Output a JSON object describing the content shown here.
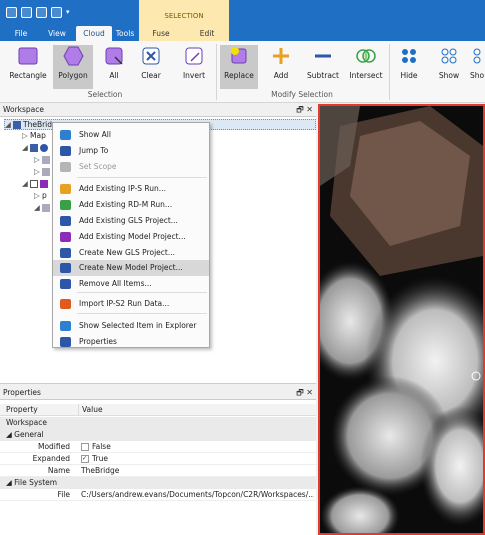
{
  "ribbon_tabs": {
    "file": "File",
    "view": "View",
    "cloud": "Cloud",
    "tools": "Tools",
    "fuse": "Fuse",
    "edit": "Edit",
    "context_group": "SELECTION"
  },
  "ribbon_buttons": {
    "rectangle": "Rectangle",
    "polygon": "Polygon",
    "all": "All",
    "clear": "Clear",
    "invert": "Invert",
    "replace": "Replace",
    "add": "Add",
    "subtract": "Subtract",
    "intersect": "Intersect",
    "hide": "Hide",
    "show": "Show",
    "show_all_partial": "Sho"
  },
  "ribbon_groups": {
    "selection": "Selection",
    "modify_selection": "Modify Selection"
  },
  "workspace": {
    "title": "Workspace",
    "root": "TheBridge",
    "map_item": "Map"
  },
  "context_menu": [
    {
      "label": "Show All",
      "icon": "show-all-icon",
      "enabled": true
    },
    {
      "label": "Jump To",
      "icon": "jump-to-icon",
      "enabled": true
    },
    {
      "label": "Set Scope",
      "icon": "set-scope-icon",
      "enabled": false
    },
    {
      "label": "Add Existing IP-S Run...",
      "icon": "ips-run-icon",
      "enabled": true
    },
    {
      "label": "Add Existing RD-M Run...",
      "icon": "rdm-run-icon",
      "enabled": true
    },
    {
      "label": "Add Existing GLS Project...",
      "icon": "gls-project-icon",
      "enabled": true
    },
    {
      "label": "Add Existing Model Project...",
      "icon": "model-project-icon",
      "enabled": true
    },
    {
      "label": "Create New GLS Project...",
      "icon": "new-gls-icon",
      "enabled": true
    },
    {
      "label": "Create New Model Project...",
      "icon": "new-model-icon",
      "enabled": true,
      "highlighted": true
    },
    {
      "label": "Remove All Items...",
      "icon": "remove-icon",
      "enabled": true
    },
    {
      "label": "Import IP-S2 Run Data...",
      "icon": "import-icon",
      "enabled": true
    },
    {
      "label": "Show Selected Item in Explorer",
      "icon": "explorer-icon",
      "enabled": true
    },
    {
      "label": "Properties",
      "icon": "properties-icon",
      "enabled": true
    }
  ],
  "properties": {
    "title": "Properties",
    "col_property": "Property",
    "col_value": "Value",
    "object": "Workspace",
    "general": "General",
    "modified_label": "Modified",
    "modified_value": "False",
    "expanded_label": "Expanded",
    "expanded_value": "True",
    "name_label": "Name",
    "name_value": "TheBridge",
    "file_system": "File System",
    "file_label": "File",
    "file_value": "C:/Users/andrew.evans/Documents/Topcon/C2R/Workspaces/..."
  },
  "colors": {
    "titlebar": "#1f6fc4",
    "context_group": "#fde9b0",
    "viewport_border": "#e23b2e",
    "selected_button": "#c9c9c9"
  }
}
